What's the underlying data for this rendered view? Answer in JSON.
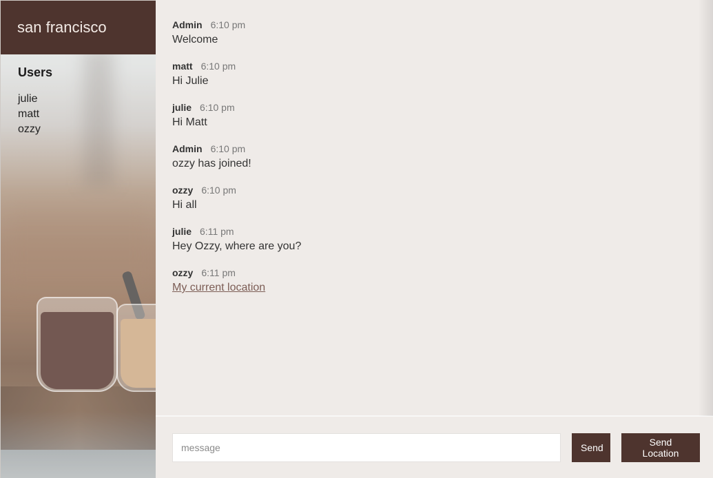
{
  "room": {
    "name": "san francisco"
  },
  "users": {
    "title": "Users",
    "list": [
      "julie",
      "matt",
      "ozzy"
    ]
  },
  "messages": [
    {
      "name": "Admin",
      "time": "6:10 pm",
      "text": "Welcome"
    },
    {
      "name": "matt",
      "time": "6:10 pm",
      "text": "Hi Julie"
    },
    {
      "name": "julie",
      "time": "6:10 pm",
      "text": "Hi Matt"
    },
    {
      "name": "Admin",
      "time": "6:10 pm",
      "text": "ozzy has joined!"
    },
    {
      "name": "ozzy",
      "time": "6:10 pm",
      "text": "Hi all"
    },
    {
      "name": "julie",
      "time": "6:11 pm",
      "text": "Hey Ozzy, where are you?"
    },
    {
      "name": "ozzy",
      "time": "6:11 pm",
      "link_text": "My current location"
    }
  ],
  "composer": {
    "placeholder": "message",
    "value": "",
    "send_label": "Send",
    "location_label": "Send Location"
  },
  "colors": {
    "accent": "#4e342e",
    "background": "#efebe8",
    "link": "#7c5d55"
  }
}
